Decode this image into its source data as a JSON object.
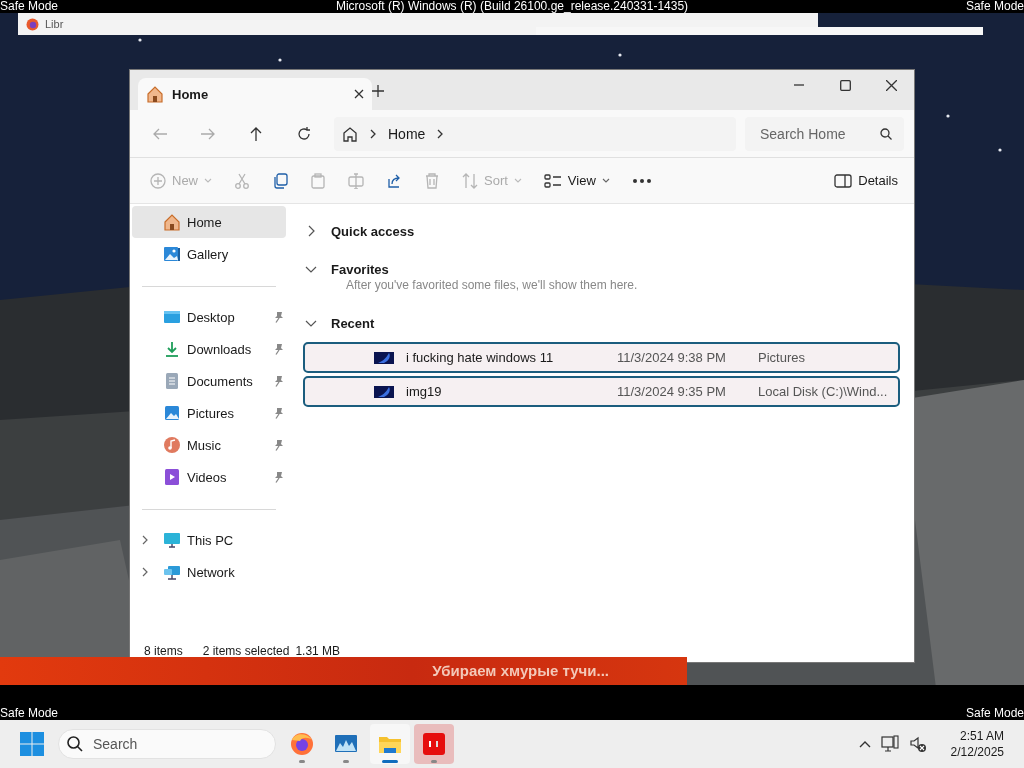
{
  "system_bar": {
    "left": "Safe Mode",
    "title": "Microsoft (R) Windows (R) (Build 26100.ge_release.240331-1435)",
    "right": "Safe Mode"
  },
  "background_window": {
    "title": "Libr"
  },
  "explorer": {
    "tabs": [
      {
        "label": "Home",
        "selected": true
      }
    ],
    "address": {
      "breadcrumb": [
        "Home"
      ],
      "search_placeholder": "Search Home"
    },
    "toolbar": [
      {
        "kind": "new",
        "label": "New",
        "disabled": true
      },
      {
        "kind": "cut",
        "disabled": true
      },
      {
        "kind": "copy",
        "disabled": false
      },
      {
        "kind": "paste",
        "disabled": true
      },
      {
        "kind": "rename",
        "disabled": true
      },
      {
        "kind": "share",
        "disabled": false
      },
      {
        "kind": "delete",
        "disabled": true
      },
      {
        "kind": "sort",
        "label": "Sort",
        "disabled": true
      },
      {
        "kind": "view",
        "label": "View",
        "disabled": false
      },
      {
        "kind": "more",
        "disabled": false
      },
      {
        "kind": "details",
        "label": "Details",
        "disabled": false
      }
    ],
    "sidebar": {
      "groups": [
        {
          "items": [
            {
              "label": "Home",
              "kind": "home",
              "selected": true,
              "pinned": false
            },
            {
              "label": "Gallery",
              "kind": "gallery",
              "selected": false,
              "pinned": false
            }
          ]
        },
        {
          "items": [
            {
              "label": "Desktop",
              "kind": "desktop",
              "selected": false,
              "pinned": true
            },
            {
              "label": "Downloads",
              "kind": "downloads",
              "selected": false,
              "pinned": true
            },
            {
              "label": "Documents",
              "kind": "documents",
              "selected": false,
              "pinned": true
            },
            {
              "label": "Pictures",
              "kind": "pictures",
              "selected": false,
              "pinned": true
            },
            {
              "label": "Music",
              "kind": "music",
              "selected": false,
              "pinned": true
            },
            {
              "label": "Videos",
              "kind": "videos",
              "selected": false,
              "pinned": true
            }
          ]
        },
        {
          "items": [
            {
              "label": "This PC",
              "kind": "pc",
              "selected": false,
              "pinned": false,
              "expandable": true
            },
            {
              "label": "Network",
              "kind": "network",
              "selected": false,
              "pinned": false,
              "expandable": true
            }
          ]
        }
      ]
    },
    "sections": [
      {
        "title": "Quick access",
        "expanded": false
      },
      {
        "title": "Favorites",
        "expanded": true,
        "message": "After you've favorited some files, we'll show them here."
      },
      {
        "title": "Recent",
        "expanded": true,
        "files": [
          {
            "name": "i fucking hate windows 11",
            "date": "11/3/2024 9:38 PM",
            "location": "Pictures",
            "selected": true
          },
          {
            "name": "img19",
            "date": "11/3/2024 9:35 PM",
            "location": "Local Disk (C:)\\Wind...",
            "selected": true
          }
        ]
      }
    ],
    "status_bar": {
      "count": "8 items",
      "selection": "2 items selected",
      "size": "1.31 MB"
    }
  },
  "banner": {
    "text": "Убираем хмурые тучи..."
  },
  "bottom_bar": {
    "left": "Safe Mode",
    "right": "Safe Mode"
  },
  "taskbar": {
    "search_placeholder": "Search",
    "apps": [
      {
        "kind": "firefox",
        "active": false,
        "hovered": false
      },
      {
        "kind": "monitor",
        "active": false,
        "hovered": false
      },
      {
        "kind": "explorer",
        "active": true,
        "hovered": false
      },
      {
        "kind": "red-app",
        "active": false,
        "hovered": true
      }
    ],
    "time": "2:51 AM",
    "date": "2/12/2025"
  }
}
